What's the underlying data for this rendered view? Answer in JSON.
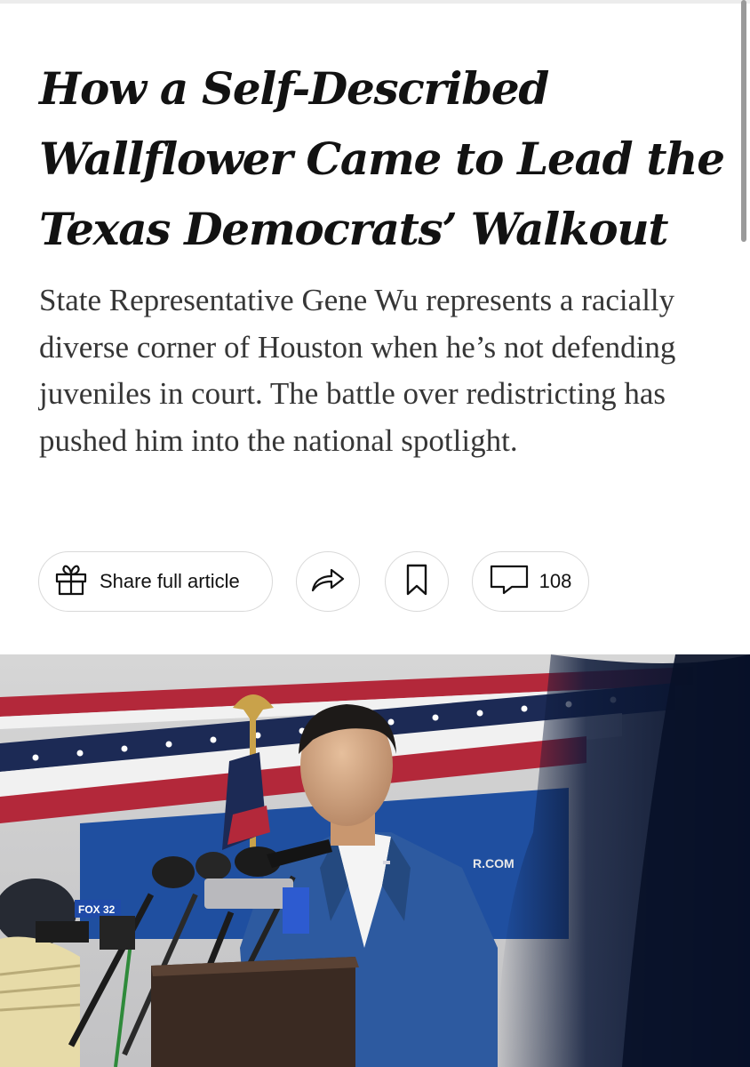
{
  "article": {
    "headline": "How a Self-Described Wallflower Came to Lead the Texas Democrats’ Walkout",
    "summary": "State Representative Gene Wu represents a racially diverse corner of Houston when he’s not defending juveniles in court. The battle over redistricting has pushed him into the national spotlight."
  },
  "actions": {
    "share_full_label": "Share full article",
    "share_full_icon": "gift-icon",
    "share_icon": "share-arrow-icon",
    "save_icon": "bookmark-icon",
    "comments_icon": "comment-bubble-icon",
    "comment_count": "108"
  },
  "photo": {
    "microphone_flag_text": "FOX 32",
    "banner_fragment": "R.COM"
  },
  "colors": {
    "headline": "#121212",
    "summary": "#363636",
    "pill_border": "#d9d9d9",
    "flag_red": "#b3283a",
    "flag_navy": "#1c2a55",
    "suit_blue": "#2d5aa0"
  }
}
